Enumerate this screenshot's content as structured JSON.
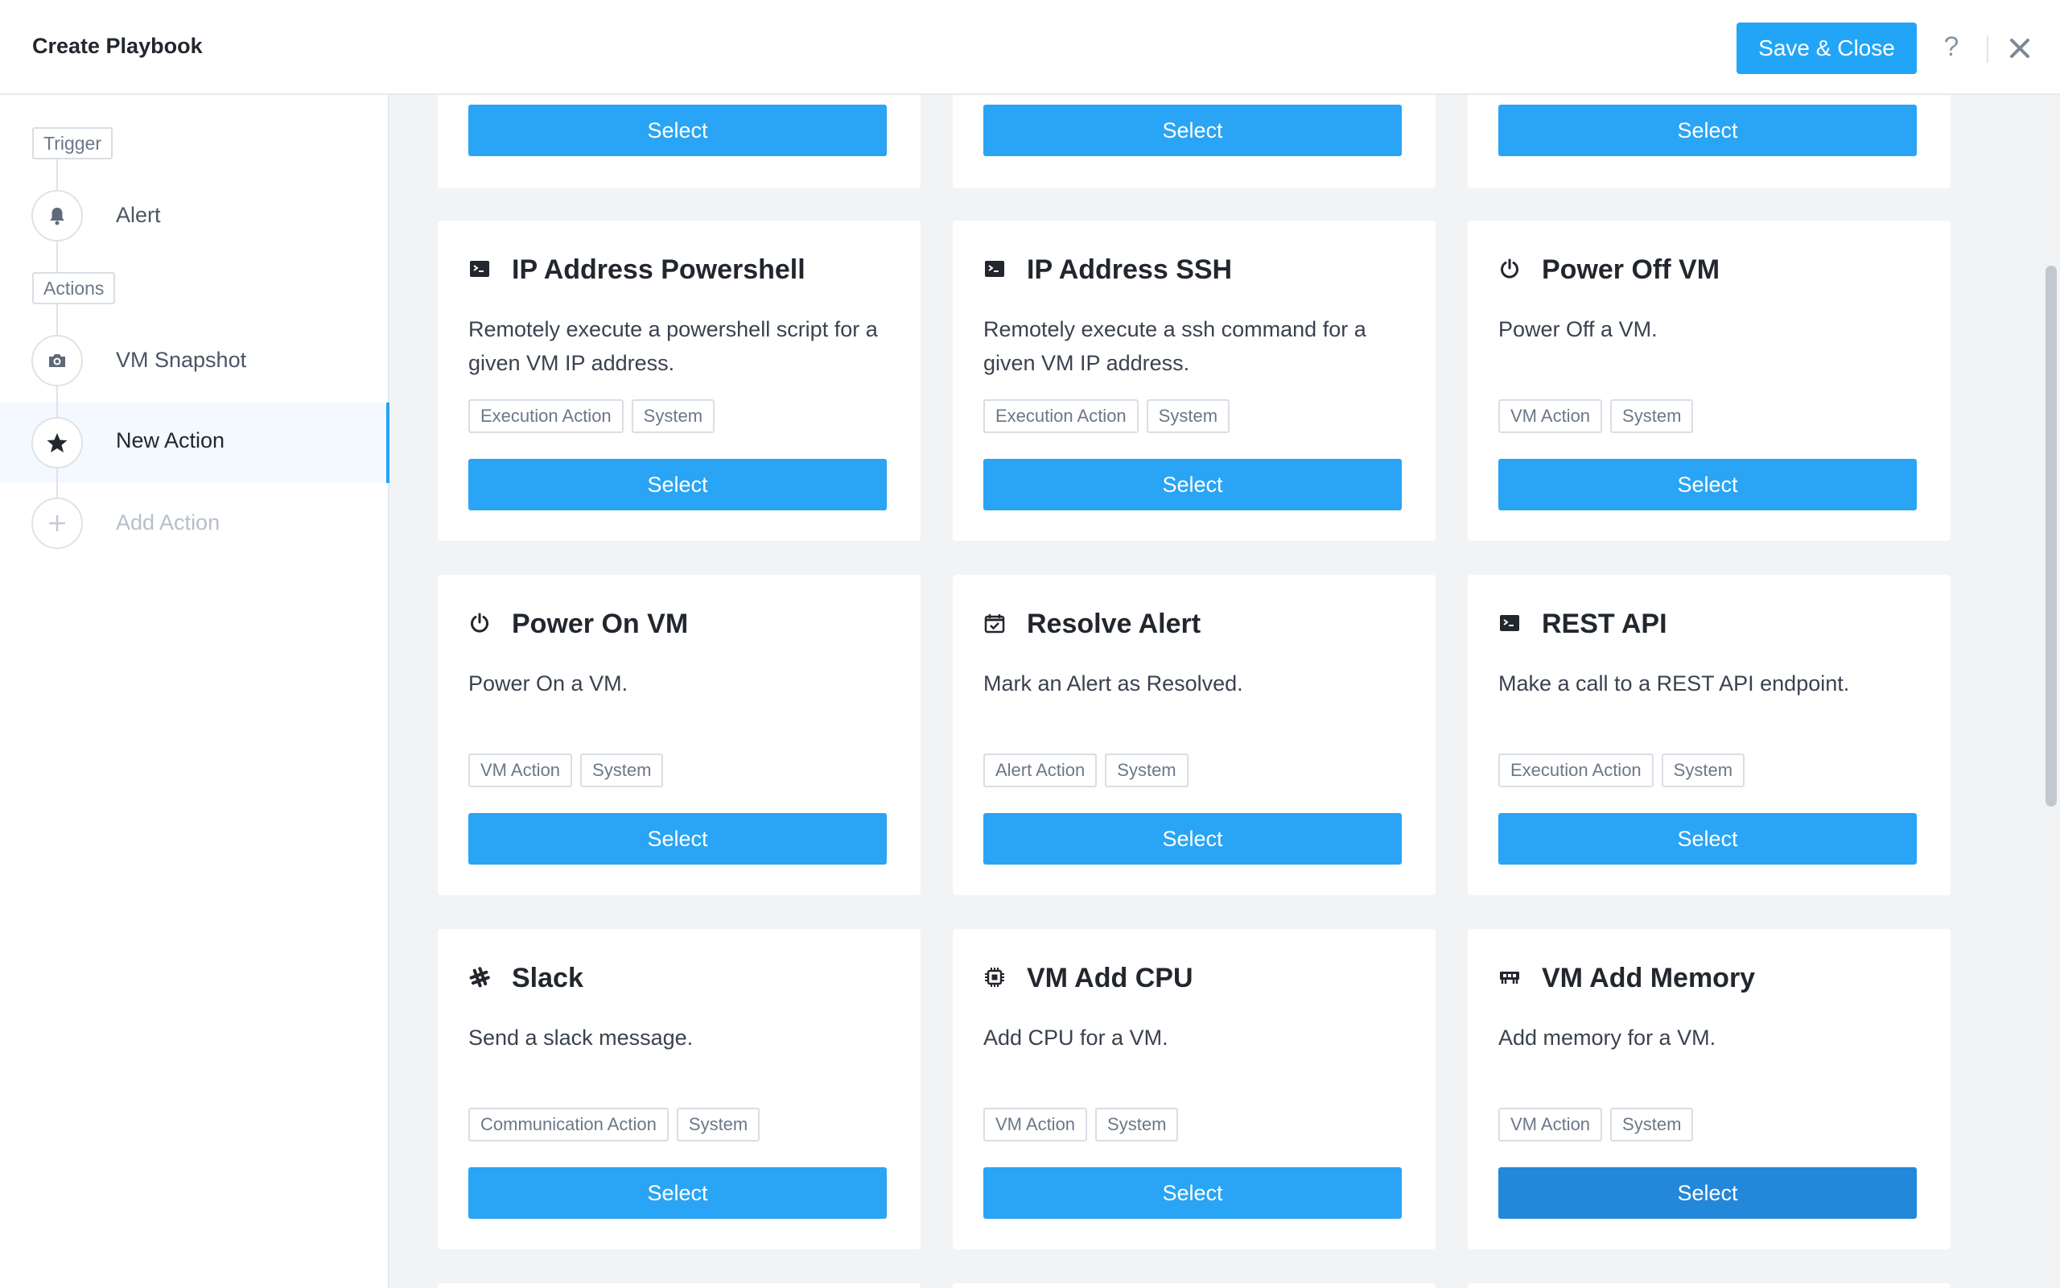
{
  "header": {
    "title": "Create Playbook",
    "save_label": "Save & Close",
    "help_label": "?"
  },
  "sidebar": {
    "trigger_tag": "Trigger",
    "actions_tag": "Actions",
    "steps": [
      {
        "label": "Alert",
        "icon": "bell-icon"
      },
      {
        "label": "VM Snapshot",
        "icon": "camera-icon"
      },
      {
        "label": "New Action",
        "icon": "star-icon",
        "active": true
      },
      {
        "label": "Add Action",
        "icon": "plus-icon",
        "disabled": true
      }
    ]
  },
  "select_label": "Select",
  "cards": [
    {
      "title": "IP Address Powershell",
      "icon": "terminal-icon",
      "description": "Remotely execute a powershell script for a given VM IP address.",
      "tags": [
        "Execution Action",
        "System"
      ]
    },
    {
      "title": "IP Address SSH",
      "icon": "terminal-icon",
      "description": "Remotely execute a ssh command for a given VM IP address.",
      "tags": [
        "Execution Action",
        "System"
      ]
    },
    {
      "title": "Power Off VM",
      "icon": "power-icon",
      "description": "Power Off a VM.",
      "tags": [
        "VM Action",
        "System"
      ]
    },
    {
      "title": "Power On VM",
      "icon": "power-icon",
      "description": "Power On a VM.",
      "tags": [
        "VM Action",
        "System"
      ]
    },
    {
      "title": "Resolve Alert",
      "icon": "calendar-check-icon",
      "description": "Mark an Alert as Resolved.",
      "tags": [
        "Alert Action",
        "System"
      ]
    },
    {
      "title": "REST API",
      "icon": "terminal-icon",
      "description": "Make a call to a REST API endpoint.",
      "tags": [
        "Execution Action",
        "System"
      ]
    },
    {
      "title": "Slack",
      "icon": "slack-icon",
      "description": "Send a slack message.",
      "tags": [
        "Communication Action",
        "System"
      ]
    },
    {
      "title": "VM Add CPU",
      "icon": "cpu-icon",
      "description": "Add CPU for a VM.",
      "tags": [
        "VM Action",
        "System"
      ]
    },
    {
      "title": "VM Add Memory",
      "icon": "memory-icon",
      "description": "Add memory for a VM.",
      "tags": [
        "VM Action",
        "System"
      ]
    }
  ],
  "colors": {
    "accent": "#22a5f7",
    "button_hover": "#2387da",
    "background": "#f2f3f5"
  }
}
